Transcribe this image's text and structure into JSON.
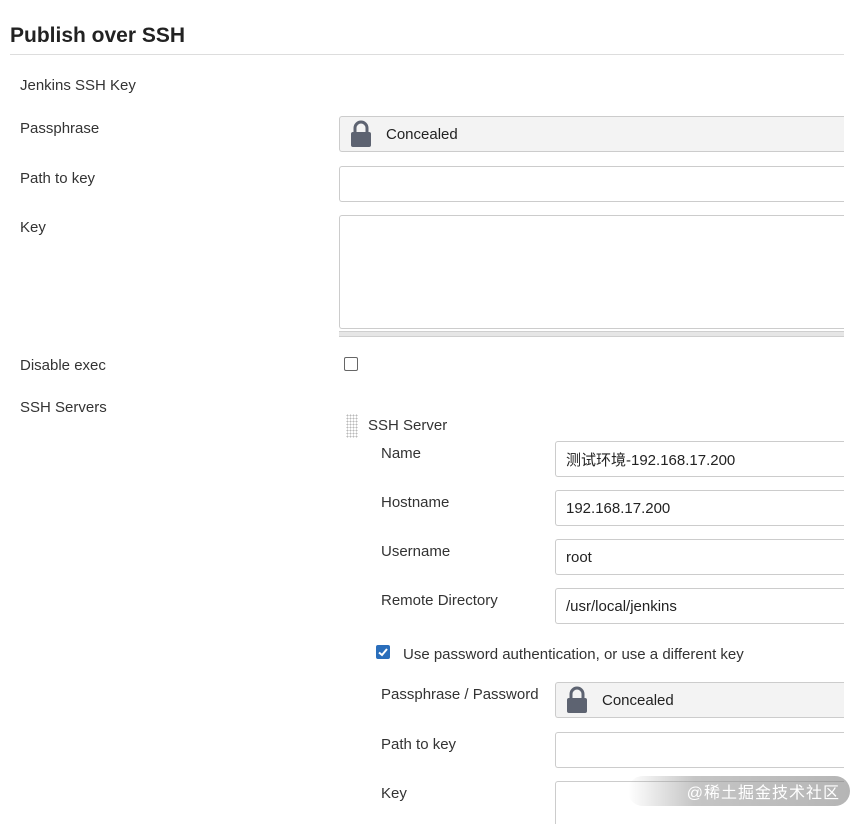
{
  "section": {
    "title": "Publish over SSH"
  },
  "global": {
    "jenkins_ssh_key_label": "Jenkins SSH Key",
    "passphrase_label": "Passphrase",
    "passphrase_value": "Concealed",
    "path_to_key_label": "Path to key",
    "path_to_key_value": "",
    "key_label": "Key",
    "key_value": "",
    "disable_exec_label": "Disable exec",
    "disable_exec_checked": false,
    "ssh_servers_label": "SSH Servers"
  },
  "ssh_server": {
    "header": "SSH Server",
    "name_label": "Name",
    "name_value": "测试环境-192.168.17.200",
    "hostname_label": "Hostname",
    "hostname_value": "192.168.17.200",
    "username_label": "Username",
    "username_value": "root",
    "remote_directory_label": "Remote Directory",
    "remote_directory_value": "/usr/local/jenkins",
    "use_password_auth_label": "Use password authentication, or use a different key",
    "use_password_auth_checked": true,
    "passphrase_password_label": "Passphrase / Password",
    "passphrase_password_value": "Concealed",
    "path_to_key_label": "Path to key",
    "path_to_key_value": "",
    "key_label": "Key"
  },
  "watermark": {
    "text": "@稀土掘金技术社区"
  },
  "icons": {
    "lock": "lock-icon",
    "check": "checkmark-icon",
    "drag": "drag-handle-icon"
  },
  "colors": {
    "checkbox_accent": "#2a6ebb",
    "lock_icon": "#5d6371",
    "concealed_bg": "#f3f3f3"
  }
}
